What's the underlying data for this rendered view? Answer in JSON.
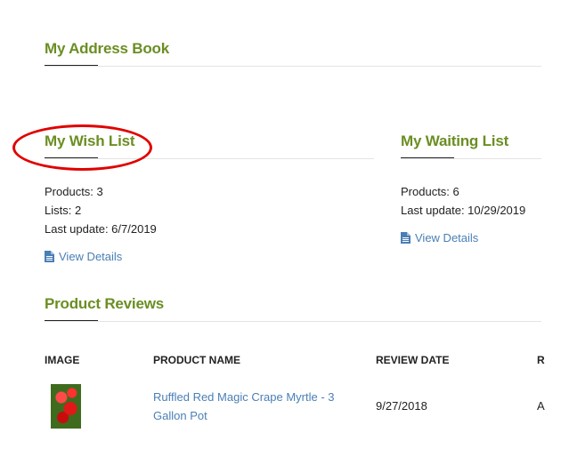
{
  "address_book": {
    "title": "My Address Book"
  },
  "wish_list": {
    "title": "My Wish List",
    "products": "Products: 3",
    "lists": "Lists: 2",
    "last_update": "Last update: 6/7/2019",
    "view_details": "View Details"
  },
  "waiting_list": {
    "title": "My Waiting List",
    "products": "Products: 6",
    "last_update": "Last update: 10/29/2019",
    "view_details": "View Details"
  },
  "reviews": {
    "title": "Product Reviews",
    "columns": [
      "IMAGE",
      "PRODUCT NAME",
      "REVIEW DATE",
      "R"
    ],
    "rows": [
      {
        "product_name": "Ruffled Red Magic Crape Myrtle - 3 Gallon Pot",
        "review_date": "9/27/2018",
        "partial": "A"
      }
    ]
  },
  "colors": {
    "heading": "#6b8e23",
    "link": "#4a7fb5",
    "highlight": "#e00000"
  },
  "icons": {
    "view_details": "document-icon"
  }
}
